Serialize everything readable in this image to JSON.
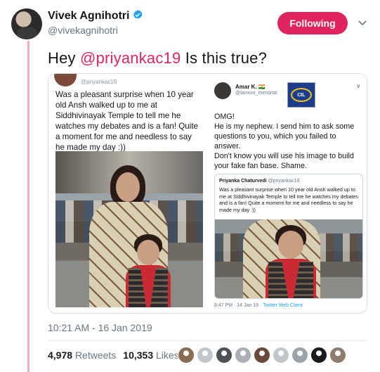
{
  "author": {
    "name": "Vivek Agnihotri",
    "handle": "@vivekagnihotri",
    "verified": true,
    "avatar_icon": "profile-photo"
  },
  "header": {
    "follow_label": "Following",
    "menu_icon": "chevron-down-icon"
  },
  "tweet": {
    "text_prefix": "Hey ",
    "mention": "@priyankac19",
    "text_suffix": " Is this true?"
  },
  "media": {
    "left": {
      "handle": "@priyankac19",
      "text": "Was a pleasant surprise when 10 year old Ansh walked up to me at Siddhivinayak Temple to tell me he watches my debates and is a fan! Quite a moment for me and needless to say he made my day :))"
    },
    "right": {
      "name": "Amar K. 🇮🇳",
      "handle": "@Iamnot_Immortal",
      "logo_text": "CIL",
      "text": "OMG!\nHe is my nephew. I send him to ask some questions to you, which you failed to answer.\nDon't know you will use his image to build your fake fan base. Shame.",
      "quote": {
        "name": "Priyanka Chaturvedi",
        "handle": "@priyankac19",
        "text": "Was a pleasant surprise when 10 year old Ansh walked up to me at Siddhivinayak Temple to tell me he watches my debates and is a fan! Quite a moment for me and needless to say he made my day :))"
      },
      "meta_time": "8:47 PM · 14 Jan 19 · ",
      "meta_client": "Twitter Web Client"
    }
  },
  "footer": {
    "timestamp": "10:21 AM - 16 Jan 2019",
    "retweets_count": "4,978",
    "retweets_label": "Retweets",
    "likes_count": "10,353",
    "likes_label": "Likes"
  },
  "colors": {
    "accent": "#e0245e",
    "thread": "#f2aeb7",
    "link": "#1da1f2",
    "muted": "#657786"
  },
  "likers": [
    {
      "color": "#8a6e54"
    },
    {
      "color": "#c2c7cc"
    },
    {
      "color": "#4c5258"
    },
    {
      "color": "#aab0b6"
    },
    {
      "color": "#6a4a3a"
    },
    {
      "color": "#c2c7cc"
    },
    {
      "color": "#9da4a9"
    },
    {
      "color": "#1b1b1b"
    },
    {
      "color": "#8f7d6d"
    }
  ]
}
